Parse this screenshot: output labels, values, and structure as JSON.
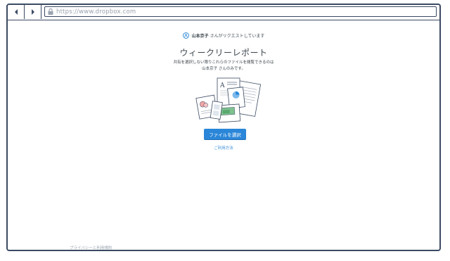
{
  "browser": {
    "url": "https://www.dropbox.com",
    "back_icon": "chevron-left-icon",
    "forward_icon": "chevron-right-icon",
    "lock_icon": "lock-icon"
  },
  "request": {
    "requester_name": "山本京子",
    "requester_suffix": "さんがリクエストしています",
    "title": "ウィークリーレポート",
    "description_line1": "共有を選択しない限りこれらのファイルを閲覧できるのは",
    "description_line2": "山本京子 さんのみです。",
    "select_button_label": "ファイルを選択",
    "howto_link": "ご利用方法"
  },
  "footer": {
    "privacy_link": "プライバシーと利用規約"
  },
  "colors": {
    "accent": "#2a86d8",
    "frame": "#3b4a63",
    "text": "#3d464d",
    "muted": "#9aa3b0"
  }
}
